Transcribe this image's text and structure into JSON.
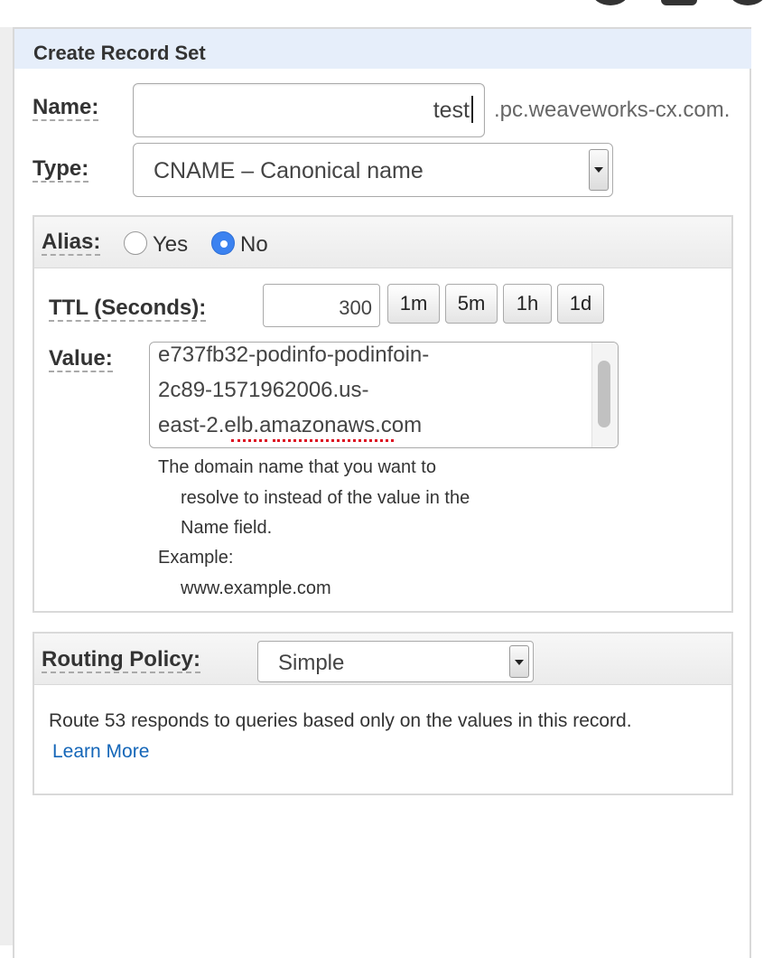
{
  "panel": {
    "title": "Create Record Set"
  },
  "name_field": {
    "label": "Name:",
    "value": "test",
    "suffix": ".pc.weaveworks-cx.com."
  },
  "type_field": {
    "label": "Type:",
    "selected": "CNAME – Canonical name"
  },
  "alias": {
    "label": "Alias:",
    "options": [
      {
        "label": "Yes",
        "selected": false
      },
      {
        "label": "No",
        "selected": true
      }
    ]
  },
  "ttl": {
    "label": "TTL (Seconds):",
    "value": "300",
    "presets": [
      "1m",
      "5m",
      "1h",
      "1d"
    ]
  },
  "value_field": {
    "label": "Value:",
    "lines": [
      "e737fb32-podinfo-podinfoin-",
      "2c89-1571962006.us-",
      "east-2.elb.amazonaws.com"
    ],
    "help_lines": [
      "The domain name that you want to",
      "resolve to instead of the value in the",
      "Name field.",
      "Example:",
      "www.example.com"
    ]
  },
  "routing": {
    "label": "Routing Policy:",
    "selected": "Simple",
    "description": "Route 53 responds to queries based only on the values in this record.",
    "learn_more": "Learn More"
  },
  "colors": {
    "header_bg": "#e6eefa",
    "radio_selected": "#3b82f0",
    "link": "#1466b8"
  }
}
